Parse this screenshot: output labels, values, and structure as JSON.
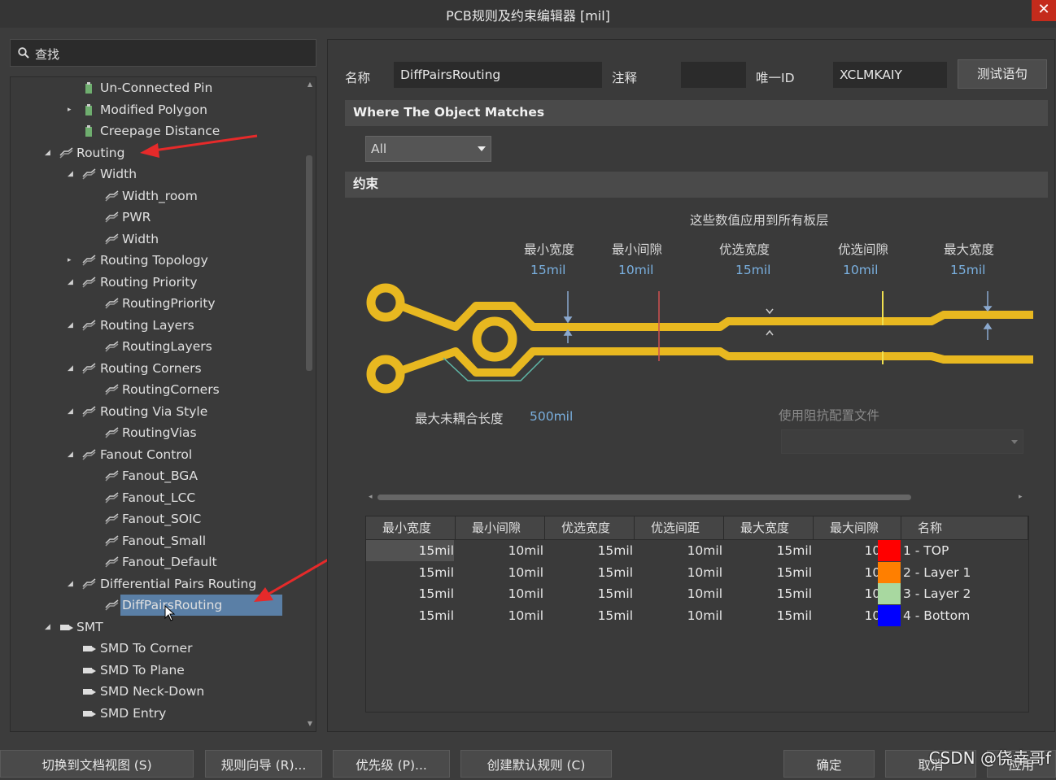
{
  "window": {
    "title": "PCB规则及约束编辑器 [mil]",
    "close": "✕"
  },
  "search": {
    "placeholder": "查找"
  },
  "tree": [
    {
      "label": "Un-Connected Pin",
      "level": 2,
      "arrow": "",
      "icon": "rule"
    },
    {
      "label": "Modified Polygon",
      "level": 2,
      "arrow": "▸",
      "icon": "rule"
    },
    {
      "label": "Creepage Distance",
      "level": 2,
      "arrow": "",
      "icon": "rule"
    },
    {
      "label": "Routing",
      "level": 1,
      "arrow": "◢",
      "icon": "cat"
    },
    {
      "label": "Width",
      "level": 2,
      "arrow": "◢",
      "icon": "cat"
    },
    {
      "label": "Width_room",
      "level": 3,
      "arrow": "",
      "icon": "cat"
    },
    {
      "label": "PWR",
      "level": 3,
      "arrow": "",
      "icon": "cat"
    },
    {
      "label": "Width",
      "level": 3,
      "arrow": "",
      "icon": "cat"
    },
    {
      "label": "Routing Topology",
      "level": 2,
      "arrow": "▸",
      "icon": "cat"
    },
    {
      "label": "Routing Priority",
      "level": 2,
      "arrow": "◢",
      "icon": "cat"
    },
    {
      "label": "RoutingPriority",
      "level": 3,
      "arrow": "",
      "icon": "cat"
    },
    {
      "label": "Routing Layers",
      "level": 2,
      "arrow": "◢",
      "icon": "cat"
    },
    {
      "label": "RoutingLayers",
      "level": 3,
      "arrow": "",
      "icon": "cat"
    },
    {
      "label": "Routing Corners",
      "level": 2,
      "arrow": "◢",
      "icon": "cat"
    },
    {
      "label": "RoutingCorners",
      "level": 3,
      "arrow": "",
      "icon": "cat"
    },
    {
      "label": "Routing Via Style",
      "level": 2,
      "arrow": "◢",
      "icon": "cat"
    },
    {
      "label": "RoutingVias",
      "level": 3,
      "arrow": "",
      "icon": "cat"
    },
    {
      "label": "Fanout Control",
      "level": 2,
      "arrow": "◢",
      "icon": "cat"
    },
    {
      "label": "Fanout_BGA",
      "level": 3,
      "arrow": "",
      "icon": "cat"
    },
    {
      "label": "Fanout_LCC",
      "level": 3,
      "arrow": "",
      "icon": "cat"
    },
    {
      "label": "Fanout_SOIC",
      "level": 3,
      "arrow": "",
      "icon": "cat"
    },
    {
      "label": "Fanout_Small",
      "level": 3,
      "arrow": "",
      "icon": "cat"
    },
    {
      "label": "Fanout_Default",
      "level": 3,
      "arrow": "",
      "icon": "cat"
    },
    {
      "label": "Differential Pairs Routing",
      "level": 2,
      "arrow": "◢",
      "icon": "cat"
    },
    {
      "label": "DiffPairsRouting",
      "level": 3,
      "arrow": "",
      "icon": "cat",
      "selected": true
    },
    {
      "label": "SMT",
      "level": 1,
      "arrow": "◢",
      "icon": "smt"
    },
    {
      "label": "SMD To Corner",
      "level": 2,
      "arrow": "",
      "icon": "smt"
    },
    {
      "label": "SMD To Plane",
      "level": 2,
      "arrow": "",
      "icon": "smt"
    },
    {
      "label": "SMD Neck-Down",
      "level": 2,
      "arrow": "",
      "icon": "smt"
    },
    {
      "label": "SMD Entry",
      "level": 2,
      "arrow": "",
      "icon": "smt"
    }
  ],
  "form": {
    "name_label": "名称",
    "name_value": "DiffPairsRouting",
    "comment_label": "注释",
    "comment_value": "",
    "id_label": "唯一ID",
    "id_value": "XCLMKAIY",
    "test_button": "测试语句"
  },
  "match_section": "Where The Object Matches",
  "match_dropdown": "All",
  "constraint_section": "约束",
  "diagram": {
    "caption": "这些数值应用到所有板层",
    "params": [
      {
        "label": "最小宽度",
        "value": "15mil"
      },
      {
        "label": "最小间隙",
        "value": "10mil"
      },
      {
        "label": "优选宽度",
        "value": "15mil"
      },
      {
        "label": "优选间隙",
        "value": "10mil"
      },
      {
        "label": "最大宽度",
        "value": "15mil"
      }
    ],
    "uncoupled_label": "最大未耦合长度",
    "uncoupled_value": "500mil",
    "impedance_label": "使用阻抗配置文件"
  },
  "table": {
    "headers": [
      "最小宽度",
      "最小间隙",
      "优选宽度",
      "优选间距",
      "最大宽度",
      "最大间隙",
      "名称"
    ],
    "rows": [
      {
        "cells": [
          "15mil",
          "10mil",
          "15mil",
          "10mil",
          "15mil",
          "10mil"
        ],
        "color": "#ff0000",
        "name": "1 - TOP"
      },
      {
        "cells": [
          "15mil",
          "10mil",
          "15mil",
          "10mil",
          "15mil",
          "10mil"
        ],
        "color": "#ff7f00",
        "name": "2 - Layer 1"
      },
      {
        "cells": [
          "15mil",
          "10mil",
          "15mil",
          "10mil",
          "15mil",
          "10mil"
        ],
        "color": "#a8d8a0",
        "name": "3 - Layer 2"
      },
      {
        "cells": [
          "15mil",
          "10mil",
          "15mil",
          "10mil",
          "15mil",
          "10mil"
        ],
        "color": "#0000ff",
        "name": "4 - Bottom"
      }
    ]
  },
  "bottom_buttons": [
    "切换到文档视图 (S)",
    "规则向导 (R)...",
    "优先级 (P)...",
    "创建默认规则 (C)",
    "确定",
    "取消",
    "应用"
  ],
  "watermark": "CSDN @侥幸哥f"
}
